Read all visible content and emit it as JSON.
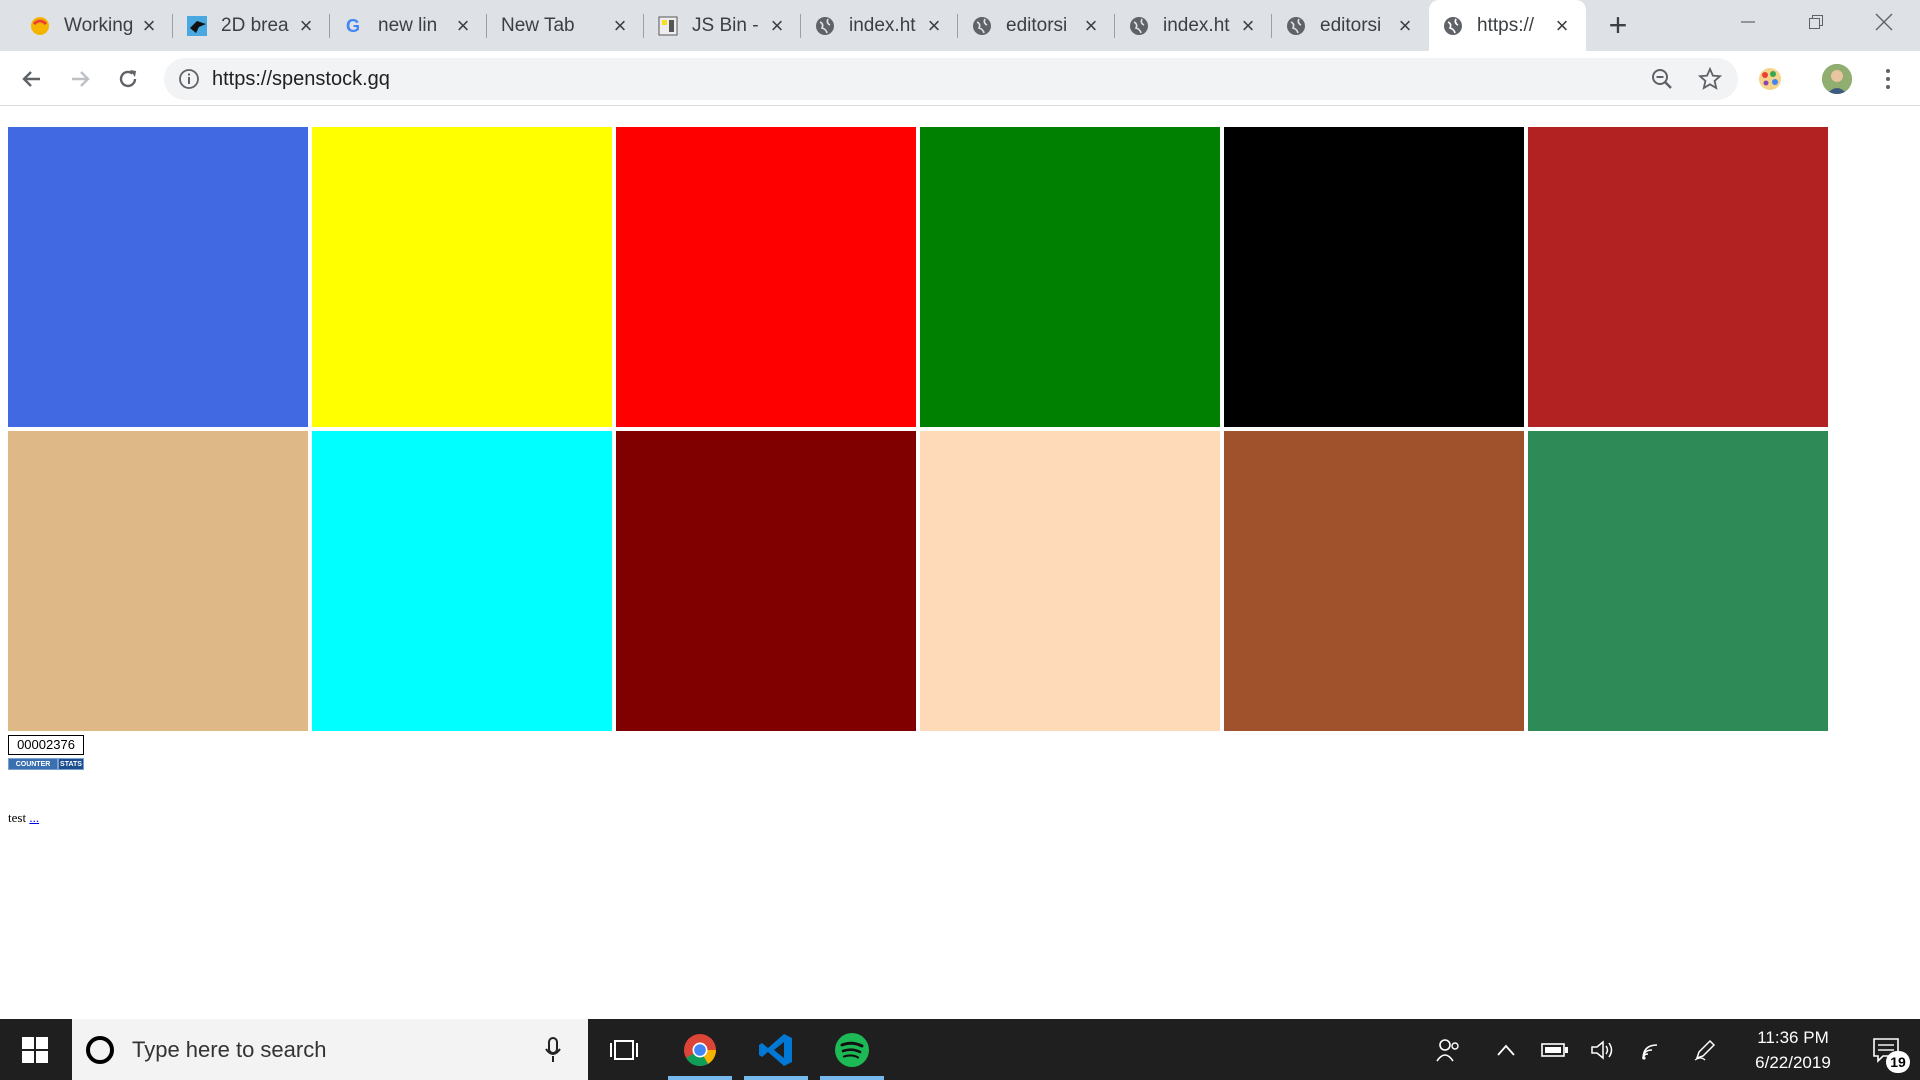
{
  "browser": {
    "tabs": [
      {
        "title": "Working",
        "favicon": "working-favicon"
      },
      {
        "title": "2D brea",
        "favicon": "bird-favicon"
      },
      {
        "title": "new lin",
        "favicon": "google-favicon"
      },
      {
        "title": "New Tab",
        "favicon": ""
      },
      {
        "title": "JS Bin -",
        "favicon": "jsbin-favicon"
      },
      {
        "title": "index.ht",
        "favicon": "globe-favicon"
      },
      {
        "title": "editorsi",
        "favicon": "globe-favicon"
      },
      {
        "title": "index.ht",
        "favicon": "globe-favicon"
      },
      {
        "title": "editorsi",
        "favicon": "globe-favicon"
      },
      {
        "title": "https://",
        "favicon": "globe-favicon",
        "active": true
      }
    ],
    "url": "https://spenstock.gq"
  },
  "page": {
    "swatches": [
      {
        "color": "#4169e1"
      },
      {
        "color": "#ffff00"
      },
      {
        "color": "#ff0000"
      },
      {
        "color": "#008000"
      },
      {
        "color": "#000000"
      },
      {
        "color": "#b22222"
      },
      {
        "color": "#deb887"
      },
      {
        "color": "#00ffff"
      },
      {
        "color": "#800000"
      },
      {
        "color": "#ffdab9"
      },
      {
        "color": "#a0522d"
      },
      {
        "color": "#2e8b57"
      }
    ],
    "counter": {
      "value": "00002376",
      "badge_left": "COUNTER",
      "badge_right": "STATS"
    },
    "test_text": "test",
    "test_link": "..."
  },
  "taskbar": {
    "search_placeholder": "Type here to search",
    "time": "11:36 PM",
    "date": "6/22/2019",
    "notification_count": "19"
  }
}
